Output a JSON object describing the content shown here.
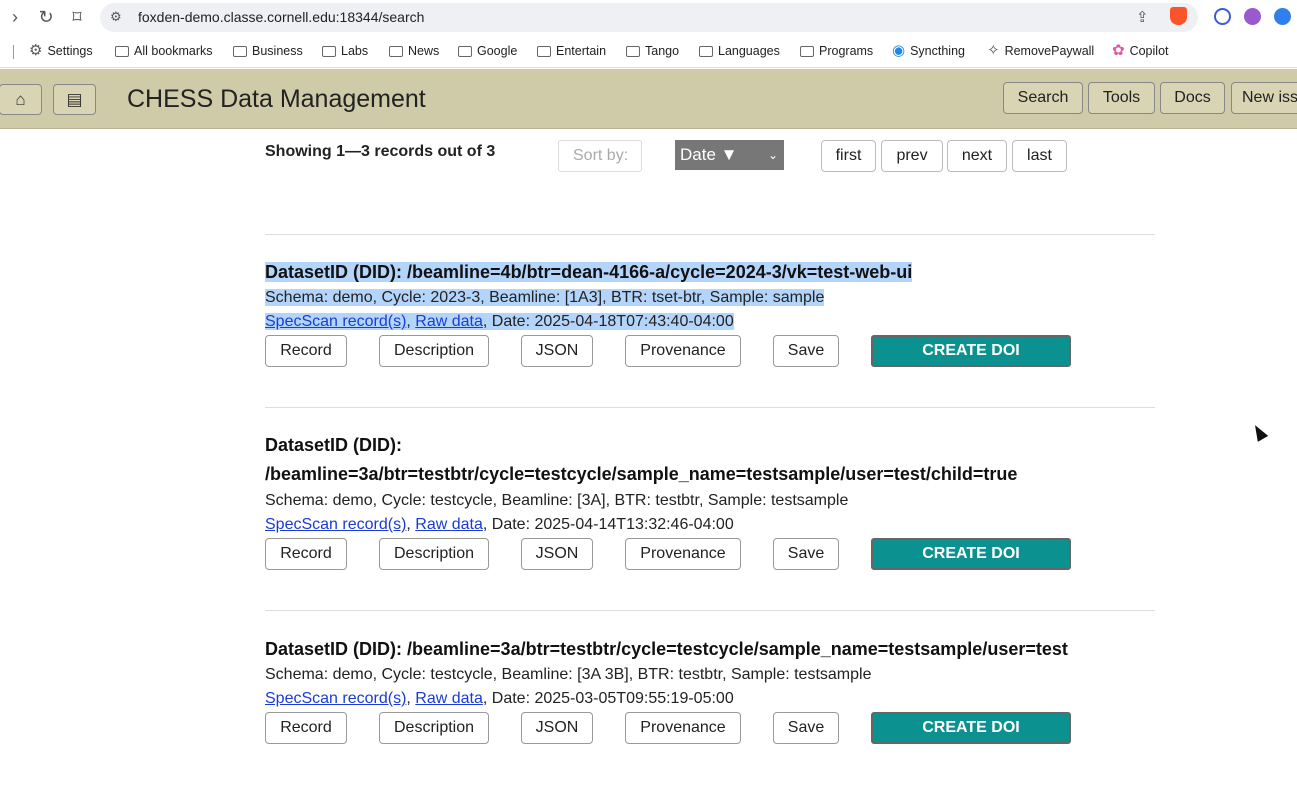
{
  "browser": {
    "url": "foxden-demo.classe.cornell.edu:18344/search",
    "bookmarks": [
      "Settings",
      "All bookmarks",
      "Business",
      "Labs",
      "News",
      "Google",
      "Entertain",
      "Tango",
      "Languages",
      "Programs",
      "Syncthing",
      "RemovePaywall",
      "Copilot"
    ]
  },
  "header": {
    "title": "CHESS Data Management",
    "buttons": [
      "Search",
      "Tools",
      "Docs",
      "New iss"
    ]
  },
  "toolbar": {
    "showing": "Showing 1—3 records out of 3",
    "sort_label": "Sort by:",
    "sort_value": "Date ▼",
    "pagination": [
      "first",
      "prev",
      "next",
      "last"
    ]
  },
  "records": [
    {
      "title": "DatasetID (DID): /beamline=4b/btr=dean-4166-a/cycle=2024-3/vk=test-web-ui",
      "title_line2": "",
      "meta": "Schema: demo, Cycle: 2023-3, Beamline: [1A3], BTR: tset-btr, Sample: sample",
      "spec_link": "SpecScan record(s)",
      "raw_link": "Raw data",
      "date": ", Date: 2025-04-18T07:43:40-04:00"
    },
    {
      "title": "DatasetID (DID):",
      "title_line2": "/beamline=3a/btr=testbtr/cycle=testcycle/sample_name=testsample/user=test/child=true",
      "meta": "Schema: demo, Cycle: testcycle, Beamline: [3A], BTR: testbtr, Sample: testsample",
      "spec_link": "SpecScan record(s)",
      "raw_link": "Raw data",
      "date": ", Date: 2025-04-14T13:32:46-04:00"
    },
    {
      "title": "DatasetID (DID): /beamline=3a/btr=testbtr/cycle=testcycle/sample_name=testsample/user=test",
      "title_line2": "",
      "meta": "Schema: demo, Cycle: testcycle, Beamline: [3A 3B], BTR: testbtr, Sample: testsample",
      "spec_link": "SpecScan record(s)",
      "raw_link": "Raw data",
      "date": ", Date: 2025-03-05T09:55:19-05:00"
    }
  ],
  "actions": {
    "record": "Record",
    "description": "Description",
    "json": "JSON",
    "provenance": "Provenance",
    "save": "Save",
    "create_doi": "CREATE DOI"
  }
}
